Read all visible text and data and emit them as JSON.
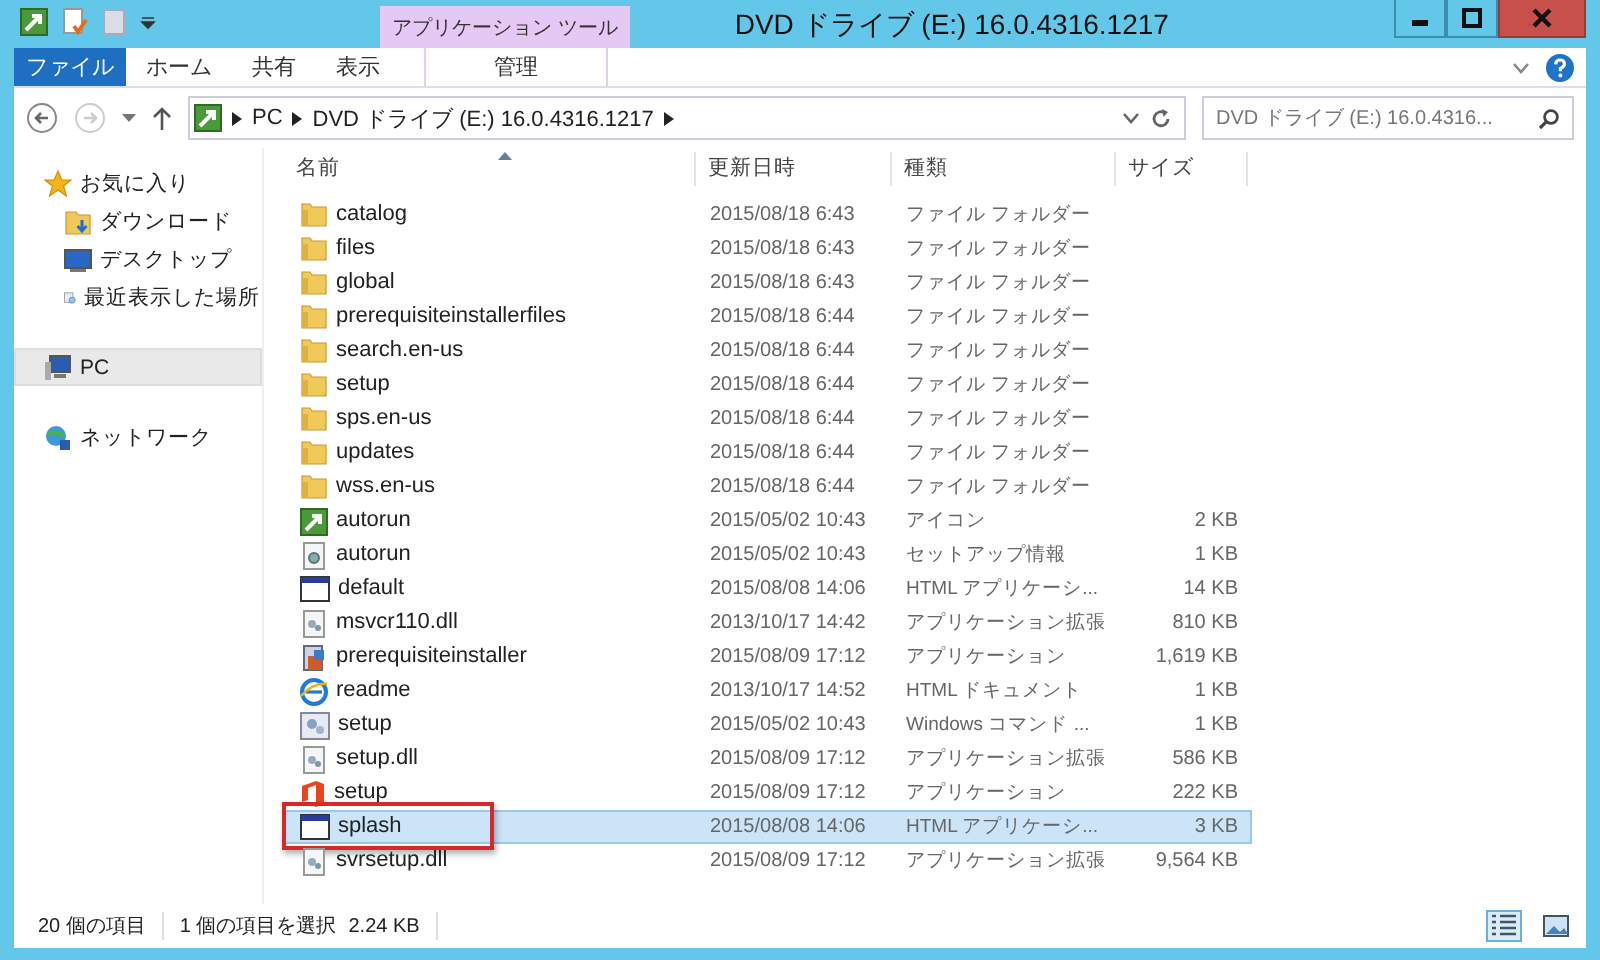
{
  "window": {
    "title": "DVD ドライブ (E:) 16.0.4316.1217"
  },
  "ribbon": {
    "context_group": "アプリケーション ツール",
    "tabs": [
      {
        "label": "ファイル",
        "kind": "file",
        "selected": false
      },
      {
        "label": "ホーム",
        "kind": "tab",
        "selected": false
      },
      {
        "label": "共有",
        "kind": "tab",
        "selected": false
      },
      {
        "label": "表示",
        "kind": "tab",
        "selected": false
      },
      {
        "label": "管理",
        "kind": "context",
        "selected": false
      }
    ]
  },
  "address": {
    "path": [
      "PC",
      "DVD ドライブ (E:) 16.0.4316.1217"
    ]
  },
  "search": {
    "placeholder": "DVD ドライブ (E:) 16.0.4316..."
  },
  "sidebar": {
    "items": [
      {
        "label": "お気に入り",
        "kind": "star",
        "selected": false,
        "children": [
          {
            "label": "ダウンロード",
            "kind": "download",
            "selected": false
          },
          {
            "label": "デスクトップ",
            "kind": "desktop",
            "selected": false
          },
          {
            "label": "最近表示した場所",
            "kind": "recent",
            "selected": false
          }
        ]
      },
      {
        "label": "PC",
        "kind": "pc",
        "selected": true
      },
      {
        "label": "ネットワーク",
        "kind": "network",
        "selected": false
      }
    ]
  },
  "table": {
    "columns": [
      "名前",
      "更新日時",
      "種類",
      "サイズ"
    ],
    "rows": [
      {
        "name": "catalog",
        "kind": "folder",
        "date": "2015/08/18 6:43",
        "type": "ファイル フォルダー",
        "selected": false,
        "highlighted": false
      },
      {
        "name": "files",
        "kind": "folder",
        "date": "2015/08/18 6:43",
        "type": "ファイル フォルダー",
        "selected": false,
        "highlighted": false
      },
      {
        "name": "global",
        "kind": "folder",
        "date": "2015/08/18 6:43",
        "type": "ファイル フォルダー",
        "selected": false,
        "highlighted": false
      },
      {
        "name": "prerequisiteinstallerfiles",
        "kind": "folder",
        "date": "2015/08/18 6:44",
        "type": "ファイル フォルダー",
        "selected": false,
        "highlighted": false
      },
      {
        "name": "search.en-us",
        "kind": "folder",
        "date": "2015/08/18 6:44",
        "type": "ファイル フォルダー",
        "selected": false,
        "highlighted": false
      },
      {
        "name": "setup",
        "kind": "folder",
        "date": "2015/08/18 6:44",
        "type": "ファイル フォルダー",
        "selected": false,
        "highlighted": false
      },
      {
        "name": "sps.en-us",
        "kind": "folder",
        "date": "2015/08/18 6:44",
        "type": "ファイル フォルダー",
        "selected": false,
        "highlighted": false
      },
      {
        "name": "updates",
        "kind": "folder",
        "date": "2015/08/18 6:44",
        "type": "ファイル フォルダー",
        "selected": false,
        "highlighted": false
      },
      {
        "name": "wss.en-us",
        "kind": "folder",
        "date": "2015/08/18 6:44",
        "type": "ファイル フォルダー",
        "selected": false,
        "highlighted": false
      },
      {
        "name": "autorun",
        "kind": "launcher",
        "date": "2015/05/02 10:43",
        "type": "アイコン",
        "size": "2 KB",
        "selected": false,
        "highlighted": false
      },
      {
        "name": "autorun",
        "kind": "settings",
        "date": "2015/05/02 10:43",
        "type": "セットアップ情報",
        "size": "1 KB",
        "selected": false,
        "highlighted": false
      },
      {
        "name": "default",
        "kind": "window",
        "date": "2015/08/08 14:06",
        "type": "HTML アプリケーシ...",
        "size": "14 KB",
        "selected": false,
        "highlighted": false
      },
      {
        "name": "msvcr110.dll",
        "kind": "dll",
        "date": "2013/10/17 14:42",
        "type": "アプリケーション拡張",
        "size": "810 KB",
        "selected": false,
        "highlighted": false
      },
      {
        "name": "prerequisiteinstaller",
        "kind": "installer",
        "date": "2015/08/09 17:12",
        "type": "アプリケーション",
        "size": "1,619 KB",
        "selected": false,
        "highlighted": false
      },
      {
        "name": "readme",
        "kind": "web",
        "date": "2013/10/17 14:52",
        "type": "HTML ドキュメント",
        "size": "1 KB",
        "selected": false,
        "highlighted": false
      },
      {
        "name": "setup",
        "kind": "script",
        "date": "2015/05/02 10:43",
        "type": "Windows コマンド ...",
        "size": "1 KB",
        "selected": false,
        "highlighted": false
      },
      {
        "name": "setup.dll",
        "kind": "dll",
        "date": "2015/08/09 17:12",
        "type": "アプリケーション拡張",
        "size": "586 KB",
        "selected": false,
        "highlighted": false
      },
      {
        "name": "setup",
        "kind": "office",
        "date": "2015/08/09 17:12",
        "type": "アプリケーション",
        "size": "222 KB",
        "selected": false,
        "highlighted": false
      },
      {
        "name": "splash",
        "kind": "window",
        "date": "2015/08/08 14:06",
        "type": "HTML アプリケーシ...",
        "size": "3 KB",
        "selected": true,
        "highlighted": true
      },
      {
        "name": "svrsetup.dll",
        "kind": "dll",
        "date": "2015/08/09 17:12",
        "type": "アプリケーション拡張",
        "size": "9,564 KB",
        "selected": false,
        "highlighted": false
      }
    ]
  },
  "status_bar": {
    "count": "20 個の項目",
    "selection": "1 個の項目を選択",
    "selection_size": "2.24 KB"
  }
}
